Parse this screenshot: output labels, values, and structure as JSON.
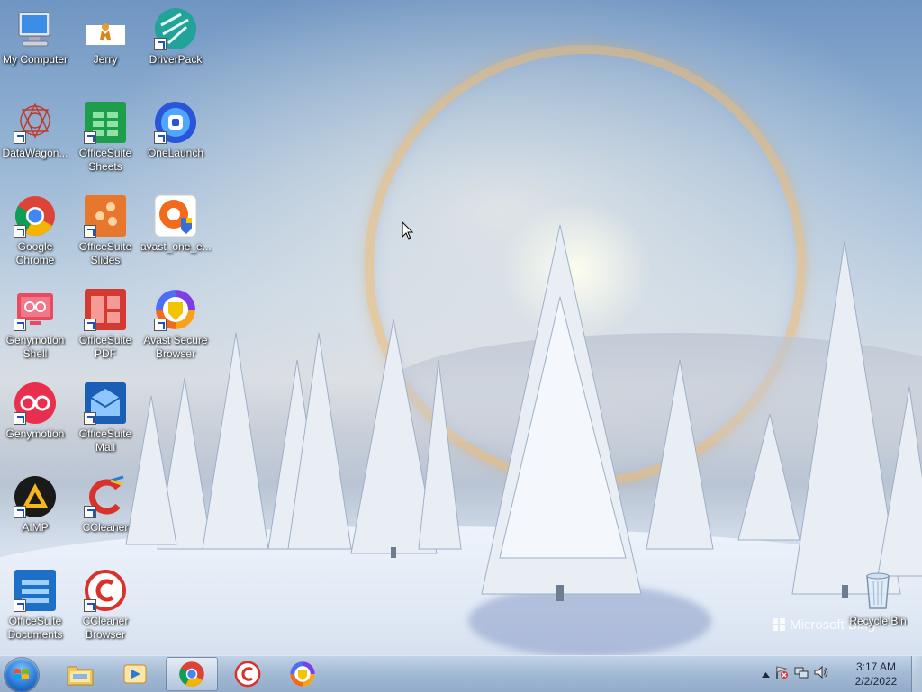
{
  "desktop": {
    "watermark": "Microsoft Bing",
    "icons": [
      {
        "label": "My Computer"
      },
      {
        "label": "Jerry"
      },
      {
        "label": "DriverPack"
      },
      {
        "label": "DataWagon..."
      },
      {
        "label": "OfficeSuite Sheets"
      },
      {
        "label": "OneLaunch"
      },
      {
        "label": "Google Chrome"
      },
      {
        "label": "OfficeSuite Slides"
      },
      {
        "label": "avast_one_e..."
      },
      {
        "label": "Genymotion Shell"
      },
      {
        "label": "OfficeSuite PDF"
      },
      {
        "label": "Avast Secure Browser"
      },
      {
        "label": "Genymotion"
      },
      {
        "label": "OfficeSuite Mail"
      },
      {
        "label": "AIMP"
      },
      {
        "label": "CCleaner"
      },
      {
        "label": "OfficeSuite Documents"
      },
      {
        "label": "CCleaner Browser"
      },
      {
        "label": "Recycle Bin"
      }
    ]
  },
  "taskbar": {
    "pinned": [
      {
        "name": "Windows Explorer",
        "icon": "folder-icon"
      },
      {
        "name": "Windows Media Player",
        "icon": "media-player-icon"
      },
      {
        "name": "Google Chrome",
        "icon": "chrome-icon",
        "active": true
      },
      {
        "name": "CCleaner Browser",
        "icon": "ccleaner-browser-icon"
      },
      {
        "name": "Avast Secure Browser",
        "icon": "avast-browser-icon"
      }
    ],
    "tray_icons": [
      "show-hidden-icons-arrow",
      "action-center-flag-icon",
      "network-icon",
      "volume-icon"
    ],
    "clock": {
      "time": "3:17 AM",
      "date": "2/2/2022"
    }
  },
  "colors": {
    "taskbar": "#a9bfd8",
    "chrome_red": "#db4437",
    "chrome_green": "#0f9d58",
    "chrome_yellow": "#f4b400",
    "chrome_blue": "#4285f4",
    "officesuite_green": "#1e9e4a",
    "officesuite_orange": "#e8772e",
    "officesuite_red": "#d33a32",
    "officesuite_blue": "#1e6fc8"
  }
}
